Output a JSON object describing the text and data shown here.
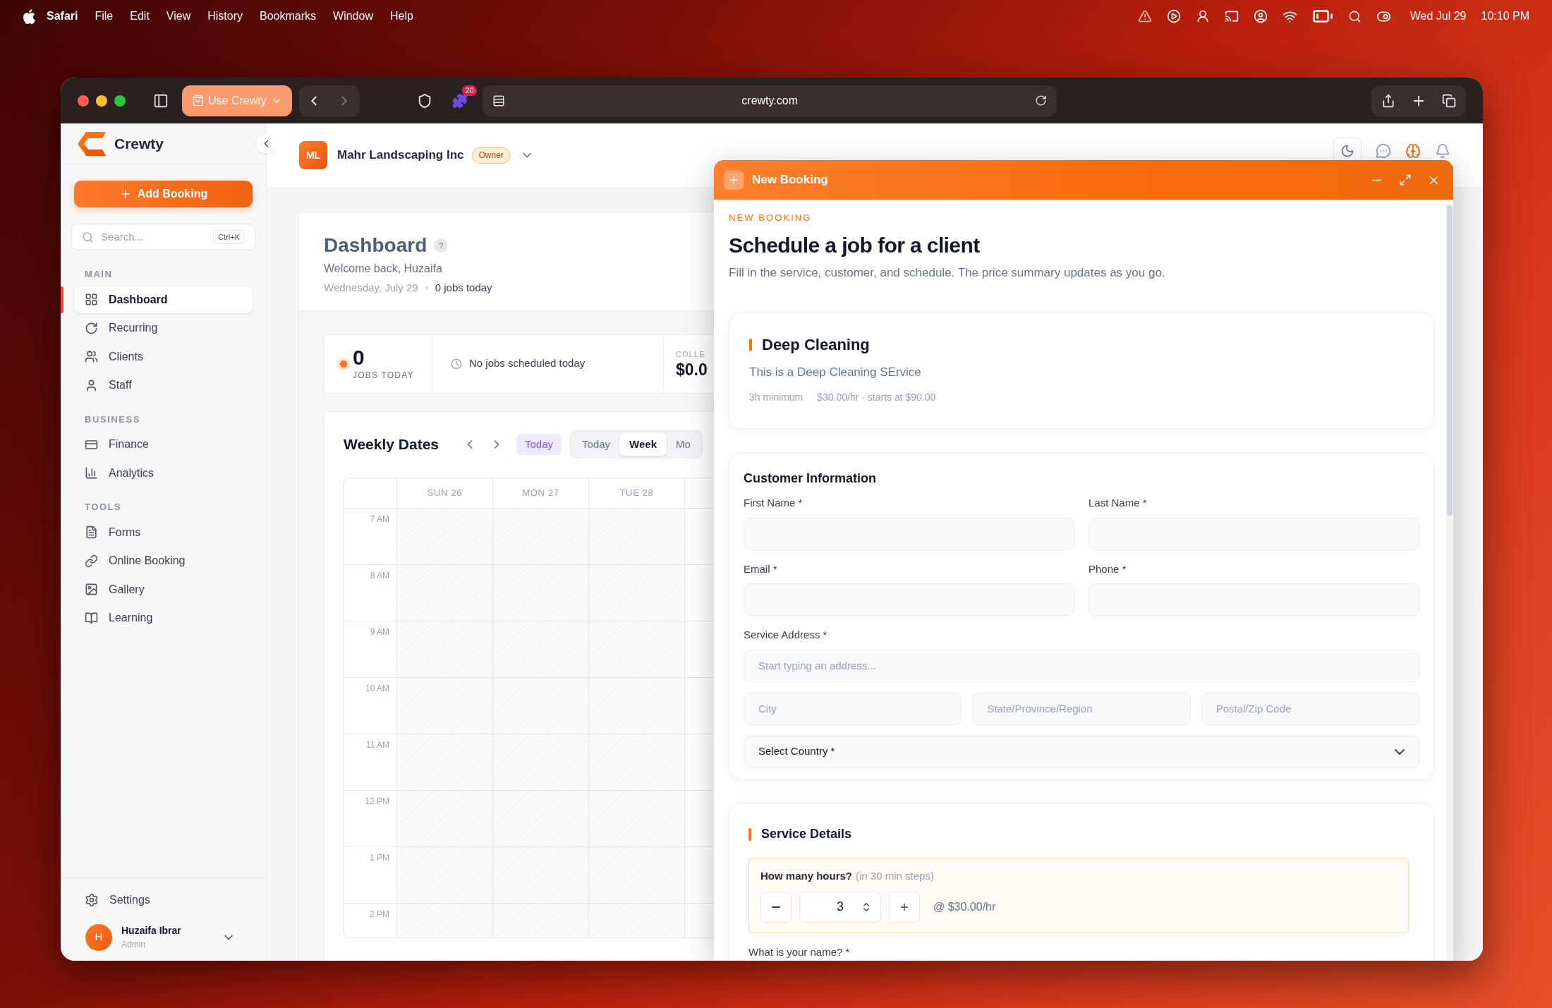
{
  "menubar": {
    "app": "Safari",
    "menus": [
      "File",
      "Edit",
      "View",
      "History",
      "Bookmarks",
      "Window",
      "Help"
    ],
    "date": "Wed Jul 29",
    "time": "10:10 PM"
  },
  "browser": {
    "profile_button": "Use Crewty",
    "extension_badge": "20",
    "url": "crewty.com"
  },
  "sidebar": {
    "brand": "Crewty",
    "add_button": "Add Booking",
    "search": {
      "placeholder": "Search...",
      "shortcut": "Ctrl+K"
    },
    "sections": [
      {
        "title": "MAIN",
        "items": [
          {
            "label": "Dashboard",
            "selected": true
          },
          {
            "label": "Recurring",
            "selected": false
          },
          {
            "label": "Clients",
            "selected": false
          },
          {
            "label": "Staff",
            "selected": false
          }
        ]
      },
      {
        "title": "BUSINESS",
        "items": [
          {
            "label": "Finance",
            "selected": false
          },
          {
            "label": "Analytics",
            "selected": false
          }
        ]
      },
      {
        "title": "TOOLS",
        "items": [
          {
            "label": "Forms",
            "selected": false
          },
          {
            "label": "Online Booking",
            "selected": false
          },
          {
            "label": "Gallery",
            "selected": false
          },
          {
            "label": "Learning",
            "selected": false
          }
        ]
      }
    ],
    "settings": "Settings",
    "user": {
      "initial": "H",
      "name": "Huzaifa Ibrar",
      "role": "Admin"
    }
  },
  "header": {
    "org_initials": "ML",
    "org_name": "Mahr Landscaping Inc",
    "role_badge": "Owner"
  },
  "dashboard": {
    "title": "Dashboard",
    "help": "?",
    "welcome": "Welcome back, Huzaifa",
    "date": "Wednesday, July 29",
    "jobs_today": "0 jobs today",
    "stats": {
      "jobs_count": "0",
      "jobs_label": "JOBS TODAY",
      "schedule_note": "No jobs scheduled today",
      "collected_label": "COLLE",
      "collected_value": "$0.0"
    }
  },
  "calendar": {
    "title": "Weekly Dates",
    "today_button": "Today",
    "views": [
      {
        "label": "Today",
        "selected": false
      },
      {
        "label": "Week",
        "selected": true
      },
      {
        "label": "Mo",
        "selected": false
      }
    ],
    "days": [
      "SUN 26",
      "MON 27",
      "TUE 28"
    ],
    "hours": [
      "7 AM",
      "8 AM",
      "9 AM",
      "10 AM",
      "11 AM",
      "12 PM",
      "1 PM",
      "2 PM"
    ]
  },
  "modal": {
    "title": "New Booking",
    "eyebrow": "NEW BOOKING",
    "heading": "Schedule a job for a client",
    "description": "Fill in the service, customer, and schedule. The price summary updates as you go.",
    "service": {
      "name": "Deep Cleaning",
      "description": "This is a Deep Cleaning SErvice",
      "minimum": "3h minimum",
      "pricing": "$30.00/hr · starts at $90.00"
    },
    "customer": {
      "title": "Customer Information",
      "fields": [
        {
          "label": "First Name *"
        },
        {
          "label": "Last Name *"
        },
        {
          "label": "Email *"
        },
        {
          "label": "Phone *"
        }
      ],
      "address": {
        "label": "Service Address *",
        "placeholder": "Start typing an address..."
      },
      "address_parts": [
        {
          "placeholder": "City"
        },
        {
          "placeholder": "State/Province/Region"
        },
        {
          "placeholder": "Postal/Zip Code"
        }
      ],
      "country": "Select Country *"
    },
    "service_details": {
      "title": "Service Details",
      "hours_label": "How many hours?",
      "hours_hint": "(in 30 min steps)",
      "hours": "3",
      "rate": "@ $30.00/hr",
      "next_label": "What is your name? *"
    }
  }
}
